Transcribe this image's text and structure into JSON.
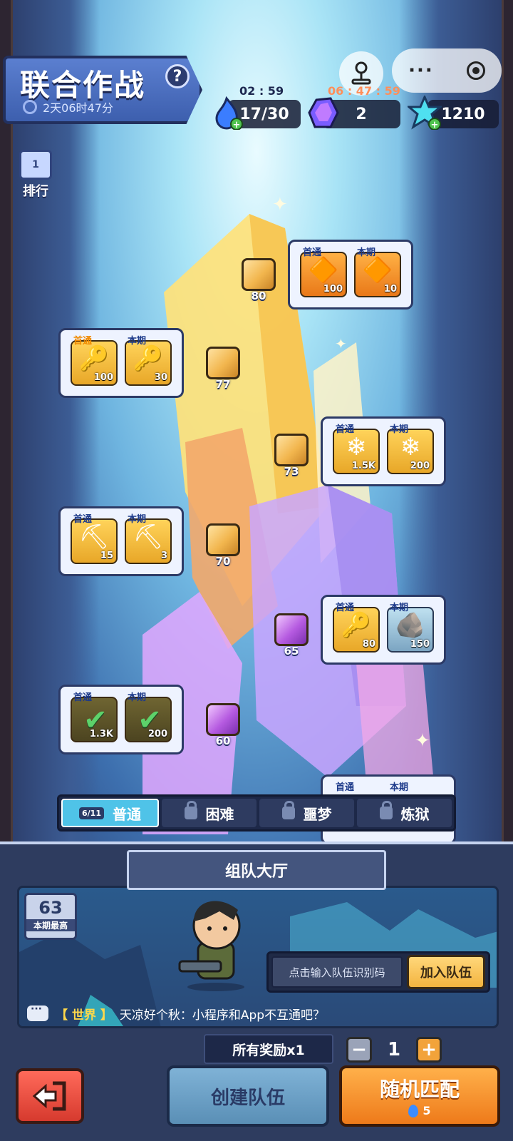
{
  "header": {
    "title": "联合作战",
    "help_label": "?",
    "countdown": "2天06时47分"
  },
  "wechat": {
    "more_label": "···"
  },
  "resources": {
    "energy": {
      "timer": "02 : 59",
      "value": "17/30",
      "icon": "blue-flame-icon"
    },
    "crystal": {
      "timer": "06 : 47 : 59",
      "value": "2",
      "icon": "purple-crystal-icon"
    },
    "gem": {
      "value": "1210",
      "icon": "cyan-gem-icon"
    }
  },
  "rank": {
    "icon_label": "1",
    "label": "排行"
  },
  "levels": [
    {
      "num": "80",
      "cube": "gold",
      "rewards": [
        {
          "tag": "首通",
          "amount": "100",
          "icon": "orange-crystal-icon"
        },
        {
          "tag": "本期",
          "amount": "10",
          "icon": "orange-crystal-icon"
        }
      ]
    },
    {
      "num": "77",
      "cube": "gold",
      "rewards": [
        {
          "tag": "首通",
          "amount": "100",
          "icon": "gold-key-icon"
        },
        {
          "tag": "本期",
          "amount": "30",
          "icon": "gold-key-icon"
        }
      ]
    },
    {
      "num": "73",
      "cube": "gold",
      "rewards": [
        {
          "tag": "首通",
          "amount": "1.5K",
          "icon": "cyan-gem-icon"
        },
        {
          "tag": "本期",
          "amount": "200",
          "icon": "cyan-gem-icon"
        }
      ]
    },
    {
      "num": "70",
      "cube": "gold",
      "rewards": [
        {
          "tag": "首通",
          "amount": "15",
          "icon": "pickaxe-icon"
        },
        {
          "tag": "本期",
          "amount": "3",
          "icon": "pickaxe-icon"
        }
      ]
    },
    {
      "num": "65",
      "cube": "purple",
      "rewards": [
        {
          "tag": "首通",
          "amount": "80",
          "icon": "gold-key-icon"
        },
        {
          "tag": "本期",
          "amount": "150",
          "icon": "ore-rock-icon"
        }
      ]
    },
    {
      "num": "60",
      "cube": "purple",
      "rewards": [
        {
          "tag": "首通",
          "amount": "1.3K",
          "icon": "checkmark-icon"
        },
        {
          "tag": "本期",
          "amount": "200",
          "icon": "checkmark-icon"
        }
      ]
    }
  ],
  "peek_card": {
    "tag1": "首通",
    "tag2": "本期"
  },
  "difficulty": {
    "badge": "6/11",
    "tabs": [
      {
        "label": "普通",
        "active": true
      },
      {
        "label": "困难",
        "locked": true
      },
      {
        "label": "噩梦",
        "locked": true
      },
      {
        "label": "炼狱",
        "locked": true
      }
    ]
  },
  "lobby": {
    "title": "组队大厅",
    "best_value": "63",
    "best_label": "本期最高",
    "code_placeholder": "点击输入队伍识别码",
    "join_label": "加入队伍",
    "chat_channel": "【 世界 】",
    "chat_message": "天凉好个秋：小程序和App不互通吧？"
  },
  "controls": {
    "reward_multiplier": "所有奖励x1",
    "minus": "−",
    "plus": "+",
    "quantity": "1",
    "create_label": "创建队伍",
    "match_label": "随机匹配",
    "match_cost": "5"
  },
  "colors": {
    "accent_blue": "#4fc3e8",
    "accent_orange": "#ee7a1a",
    "panel": "#2e3c5f"
  }
}
